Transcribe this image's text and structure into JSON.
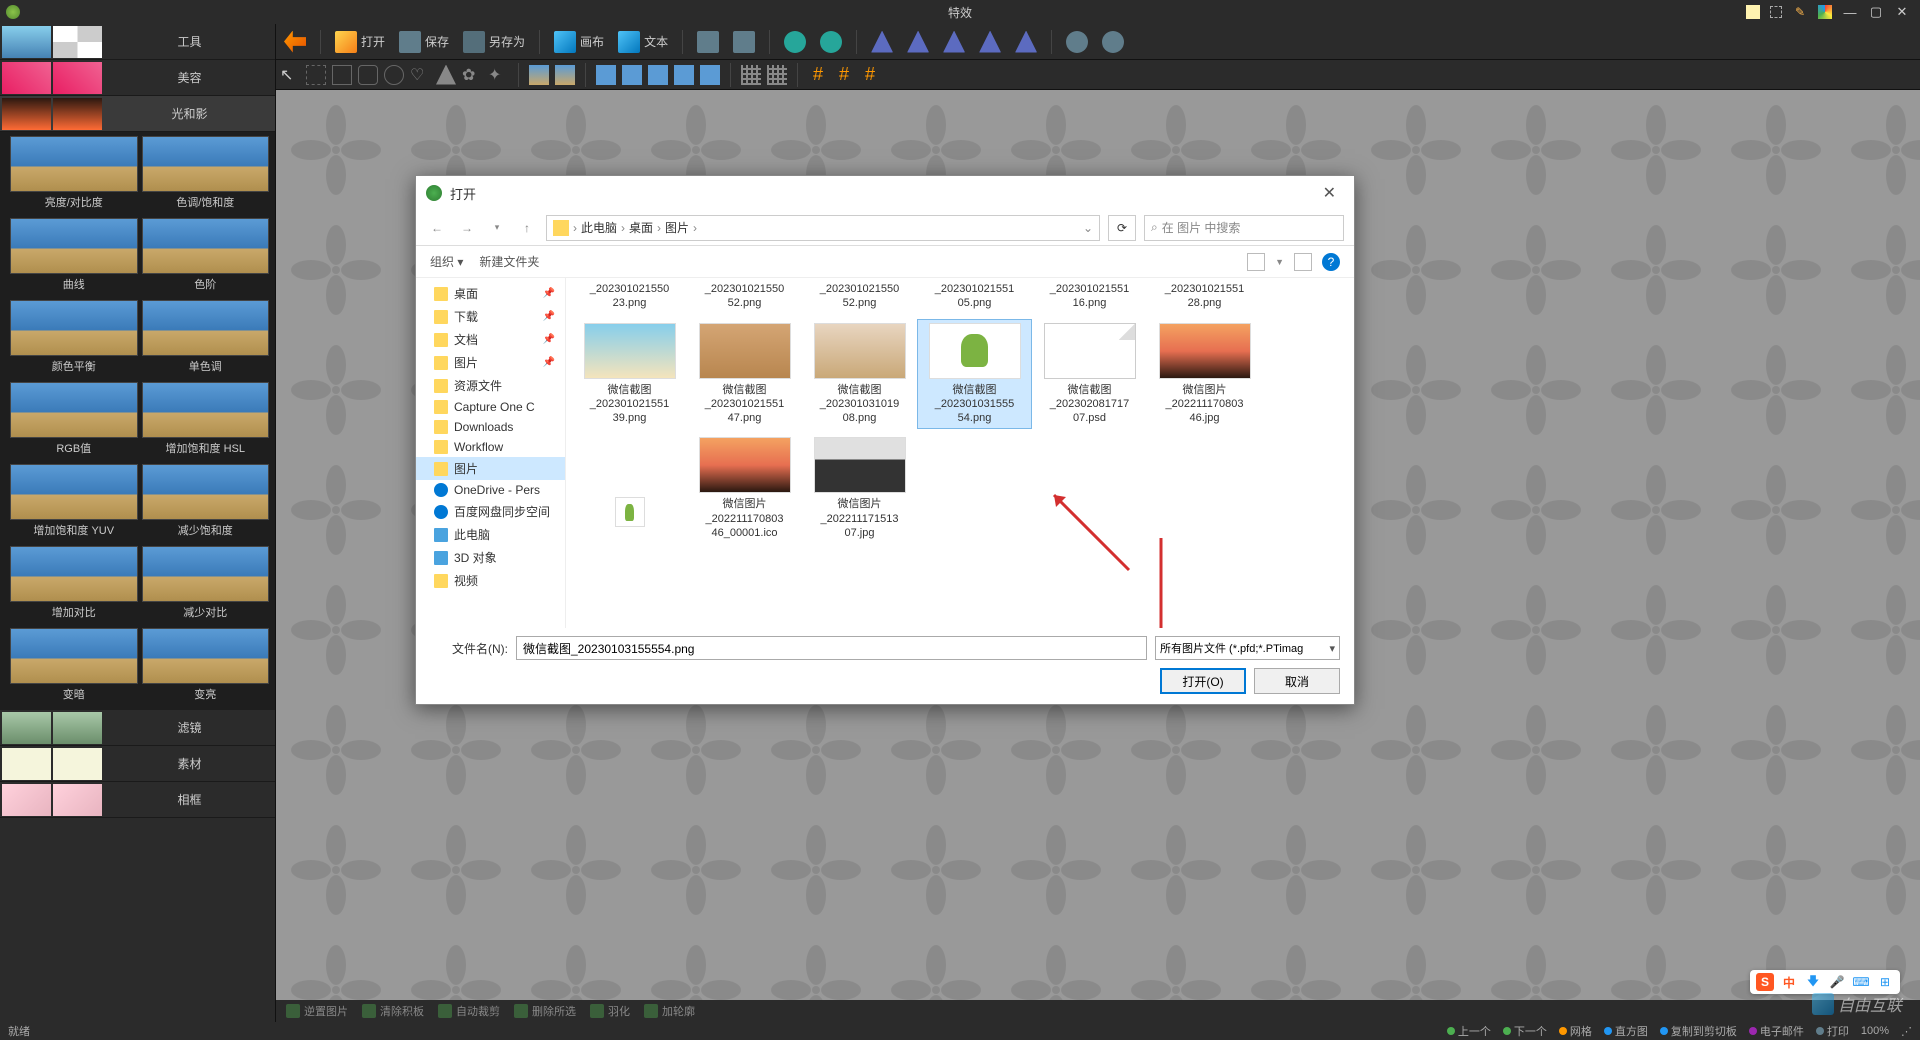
{
  "title": "特效",
  "main_toolbar": {
    "open": "打开",
    "save": "保存",
    "saveas": "另存为",
    "canvas": "画布",
    "text": "文本"
  },
  "sidebar": {
    "categories": [
      {
        "id": "tools",
        "label": "工具"
      },
      {
        "id": "beauty",
        "label": "美容"
      },
      {
        "id": "light",
        "label": "光和影"
      }
    ],
    "effects": [
      {
        "label": "亮度/对比度"
      },
      {
        "label": "色调/饱和度"
      },
      {
        "label": "曲线"
      },
      {
        "label": "色阶"
      },
      {
        "label": "颜色平衡"
      },
      {
        "label": "单色调"
      },
      {
        "label": "RGB值"
      },
      {
        "label": "增加饱和度 HSL"
      },
      {
        "label": "增加饱和度 YUV"
      },
      {
        "label": "减少饱和度"
      },
      {
        "label": "增加对比"
      },
      {
        "label": "减少对比"
      },
      {
        "label": "变暗"
      },
      {
        "label": "变亮"
      }
    ],
    "bottom_cats": [
      {
        "id": "filter",
        "label": "滤镜"
      },
      {
        "id": "material",
        "label": "素材"
      },
      {
        "id": "frame",
        "label": "相框"
      }
    ]
  },
  "action_bar": [
    "逆置图片",
    "清除积板",
    "自动裁剪",
    "删除所选",
    "羽化",
    "加轮廓"
  ],
  "status": {
    "left": "就绪",
    "items": [
      "上一个",
      "下一个",
      "网格",
      "直方图",
      "复制到剪切板",
      "电子邮件",
      "打印",
      "100%"
    ]
  },
  "dialog": {
    "title": "打开",
    "breadcrumbs": [
      "此电脑",
      "桌面",
      "图片"
    ],
    "search_placeholder": "在 图片 中搜索",
    "organize": "组织",
    "new_folder": "新建文件夹",
    "tree": [
      {
        "label": "桌面",
        "icon": "folder",
        "pin": true
      },
      {
        "label": "下载",
        "icon": "folder",
        "pin": true
      },
      {
        "label": "文档",
        "icon": "folder",
        "pin": true
      },
      {
        "label": "图片",
        "icon": "folder",
        "pin": true
      },
      {
        "label": "资源文件",
        "icon": "folder"
      },
      {
        "label": "Capture One C",
        "icon": "folder"
      },
      {
        "label": "Downloads",
        "icon": "folder"
      },
      {
        "label": "Workflow",
        "icon": "folder"
      },
      {
        "label": "图片",
        "icon": "folder",
        "selected": true
      },
      {
        "label": "OneDrive - Pers",
        "icon": "cloud"
      },
      {
        "label": "百度网盘同步空间",
        "icon": "cloud"
      },
      {
        "label": "此电脑",
        "icon": "pc"
      },
      {
        "label": "3D 对象",
        "icon": "cube"
      },
      {
        "label": "视频",
        "icon": "folder"
      }
    ],
    "files_row1": [
      {
        "name": "_202301021550\n23.png"
      },
      {
        "name": "_202301021550\n52.png"
      },
      {
        "name": "_202301021550\n52.png"
      },
      {
        "name": "_202301021551\n05.png"
      },
      {
        "name": "_202301021551\n16.png"
      },
      {
        "name": "_202301021551\n28.png"
      }
    ],
    "files_row2": [
      {
        "name": "微信截图\n_202301021551\n39.png",
        "thumb": "sky"
      },
      {
        "name": "微信截图\n_202301021551\n47.png",
        "thumb": "person"
      },
      {
        "name": "微信截图\n_202301031019\n08.png",
        "thumb": "girl"
      },
      {
        "name": "微信截图\n_202301031555\n54.png",
        "thumb": "turtle",
        "selected": true
      },
      {
        "name": "微信截图\n_202302081717\n07.psd",
        "thumb": "psd"
      },
      {
        "name": "微信图片\n_202211170803\n46.jpg",
        "thumb": "sunset"
      }
    ],
    "files_row3": [
      {
        "name": "微信图片\n_202211170803\n46_00001.ico",
        "thumb": "sunset"
      },
      {
        "name": "微信图片\n_202211171513\n07.jpg",
        "thumb": "keyboard"
      }
    ],
    "filename_label": "文件名(N):",
    "filename_value": "微信截图_20230103155554.png",
    "filetype": "所有图片文件 (*.pfd;*.PTimag",
    "open_btn": "打开(O)",
    "cancel_btn": "取消"
  },
  "ime": {
    "s": "S",
    "cn": "中"
  },
  "watermark": "自由互联"
}
